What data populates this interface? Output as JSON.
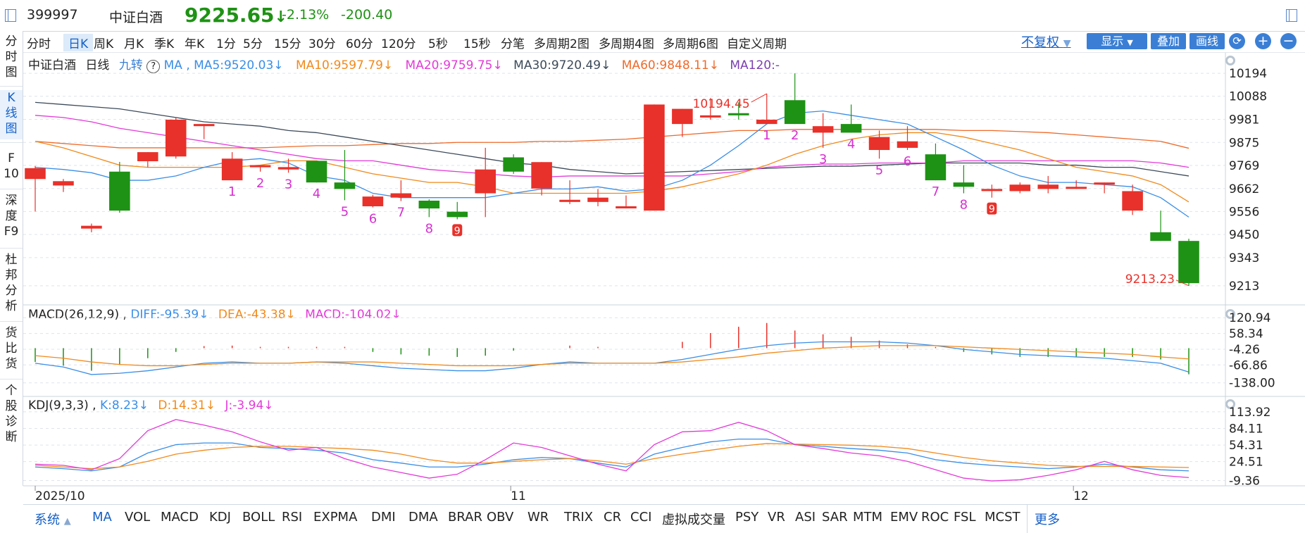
{
  "header": {
    "code": "399997",
    "name": "中证白酒",
    "price": "9225.65",
    "arrow": "↓",
    "pct": "-2.13%",
    "chg": "-200.40"
  },
  "sidebar": [
    "分时图",
    "K线图",
    "F10",
    "深度F9",
    "杜邦分析",
    "货比货",
    "个股诊断"
  ],
  "periods": [
    "分时",
    "日K",
    "周K",
    "月K",
    "季K",
    "年K",
    "1分",
    "5分",
    "15分",
    "30分",
    "60分",
    "120分",
    "5秒",
    "15秒",
    "分笔",
    "多周期2图",
    "多周期4图",
    "多周期6图",
    "自定义周期"
  ],
  "toolbar": {
    "fq": "不复权",
    "show": "显示",
    "overlay": "叠加",
    "draw": "画线",
    "plus": "+",
    "minus": "−"
  },
  "kline_title": {
    "name": "中证白酒",
    "type": "日线",
    "jz": "九转",
    "q": "?",
    "ma": "MA ,",
    "ma5": "MA5:9520.03↓",
    "ma10": "MA10:9597.79↓",
    "ma20": "MA20:9759.75↓",
    "ma30": "MA30:9720.49↓",
    "ma60": "MA60:9848.11↓",
    "ma120": "MA120:-"
  },
  "macd_title": {
    "name": "MACD(26,12,9) ,",
    "diff": "DIFF:-95.39↓",
    "dea": "DEA:-43.38↓",
    "macd": "MACD:-104.02↓"
  },
  "kdj_title": {
    "name": "KDJ(9,3,3) ,",
    "k": "K:8.23↓",
    "d": "D:14.31↓",
    "j": "J:-3.94↓"
  },
  "colors": {
    "up": "#e8312a",
    "down": "#1e9214",
    "ma5": "#3a8ee6",
    "ma10": "#f08a1c",
    "ma20": "#e33ad8",
    "ma30": "#3c4a5a",
    "ma60": "#ef6a2a",
    "ma120": "#7b3fb0"
  },
  "bottom_tabs": [
    "系统",
    "MA",
    "VOL",
    "MACD",
    "KDJ",
    "BOLL",
    "RSI",
    "EXPMA",
    "DMI",
    "DMA",
    "BRAR",
    "OBV",
    "WR",
    "TRIX",
    "CR",
    "CCI",
    "虚拟成交量",
    "PSY",
    "VR",
    "ASI",
    "SAR",
    "MTM",
    "EMV",
    "ROC",
    "FSL",
    "MCST"
  ],
  "more": "更多",
  "chart_data": {
    "type": "candlestick",
    "dates": [
      "2025/10",
      "11",
      "12"
    ],
    "date_index": [
      0,
      17,
      37
    ],
    "ylim": [
      9180,
      10240
    ],
    "y_ticks": [
      10194,
      10088,
      9981,
      9875,
      9769,
      9662,
      9556,
      9450,
      9343,
      9213
    ],
    "candles": [
      [
        9706,
        9766,
        9556,
        9756
      ],
      [
        9676,
        9706,
        9646,
        9696
      ],
      [
        9477,
        9500,
        9460,
        9490
      ],
      [
        9740,
        9785,
        9550,
        9560
      ],
      [
        9788,
        9820,
        9760,
        9830
      ],
      [
        9810,
        9990,
        9800,
        9980
      ],
      [
        9950,
        9900,
        9890,
        9960
      ],
      [
        9700,
        9830,
        9740,
        9800
      ],
      [
        9761,
        9770,
        9740,
        9770
      ],
      [
        9750,
        9800,
        9735,
        9761
      ],
      [
        9790,
        9730,
        9710,
        9690
      ],
      [
        9690,
        9840,
        9608,
        9660
      ],
      [
        9580,
        9633,
        9575,
        9625
      ],
      [
        9620,
        9700,
        9604,
        9640
      ],
      [
        9606,
        9612,
        9530,
        9570
      ],
      [
        9555,
        9600,
        9520,
        9530
      ],
      [
        9640,
        9850,
        9530,
        9750
      ],
      [
        9806,
        9820,
        9730,
        9740
      ],
      [
        9662,
        9780,
        9630,
        9784
      ],
      [
        9600,
        9700,
        9590,
        9610
      ],
      [
        9600,
        9660,
        9580,
        9620
      ],
      [
        9580,
        9630,
        9570,
        9580
      ],
      [
        9560,
        10050,
        9560,
        10050
      ],
      [
        9960,
        10010,
        9900,
        10030
      ],
      [
        9990,
        10080,
        9980,
        10000
      ],
      [
        10010,
        10060,
        9980,
        10000
      ],
      [
        9960,
        10100,
        9960,
        9980
      ],
      [
        10070,
        10194,
        10000,
        9960
      ],
      [
        9920,
        10010,
        9850,
        9950
      ],
      [
        9960,
        10050,
        9920,
        9920
      ],
      [
        9840,
        9930,
        9800,
        9900
      ],
      [
        9850,
        9950,
        9840,
        9880
      ],
      [
        9820,
        9870,
        9730,
        9700
      ],
      [
        9690,
        9770,
        9640,
        9670
      ],
      [
        9659,
        9680,
        9620,
        9660
      ],
      [
        9650,
        9690,
        9640,
        9680
      ],
      [
        9660,
        9720,
        9640,
        9680
      ],
      [
        9670,
        9700,
        9660,
        9670
      ],
      [
        9680,
        9690,
        9640,
        9690
      ],
      [
        9560,
        9680,
        9540,
        9650
      ],
      [
        9460,
        9560,
        9440,
        9420
      ],
      [
        9420,
        9430,
        9213,
        9225
      ]
    ],
    "ma5": [
      9760,
      9750,
      9735,
      9700,
      9700,
      9720,
      9760,
      9790,
      9800,
      9780,
      9720,
      9700,
      9640,
      9620,
      9620,
      9620,
      9620,
      9640,
      9660,
      9660,
      9670,
      9650,
      9660,
      9700,
      9770,
      9860,
      9960,
      10010,
      10020,
      10000,
      9980,
      9960,
      9900,
      9840,
      9770,
      9720,
      9690,
      9690,
      9680,
      9670,
      9620,
      9530
    ],
    "ma10": [
      9880,
      9850,
      9810,
      9770,
      9760,
      9760,
      9760,
      9760,
      9770,
      9790,
      9790,
      9760,
      9730,
      9710,
      9690,
      9690,
      9670,
      9640,
      9640,
      9640,
      9640,
      9640,
      9650,
      9670,
      9700,
      9730,
      9770,
      9820,
      9860,
      9890,
      9910,
      9920,
      9920,
      9900,
      9870,
      9840,
      9800,
      9760,
      9740,
      9720,
      9680,
      9600
    ],
    "ma20": [
      10000,
      9990,
      9970,
      9940,
      9920,
      9900,
      9880,
      9860,
      9840,
      9820,
      9800,
      9790,
      9790,
      9770,
      9750,
      9740,
      9730,
      9720,
      9715,
      9720,
      9720,
      9720,
      9720,
      9720,
      9730,
      9740,
      9760,
      9770,
      9775,
      9775,
      9780,
      9780,
      9780,
      9790,
      9790,
      9790,
      9790,
      9790,
      9790,
      9790,
      9780,
      9760
    ],
    "ma30": [
      10060,
      10050,
      10040,
      10030,
      10010,
      9990,
      9970,
      9960,
      9950,
      9930,
      9920,
      9900,
      9880,
      9860,
      9840,
      9820,
      9800,
      9780,
      9770,
      9750,
      9740,
      9730,
      9735,
      9740,
      9745,
      9750,
      9755,
      9760,
      9765,
      9765,
      9770,
      9775,
      9780,
      9780,
      9780,
      9780,
      9770,
      9770,
      9760,
      9760,
      9740,
      9720
    ],
    "ma60": [
      9880,
      9870,
      9860,
      9850,
      9850,
      9850,
      9850,
      9850,
      9850,
      9855,
      9860,
      9860,
      9865,
      9870,
      9870,
      9875,
      9875,
      9875,
      9880,
      9880,
      9885,
      9890,
      9900,
      9910,
      9920,
      9930,
      9930,
      9935,
      9935,
      9935,
      9935,
      9935,
      9935,
      9930,
      9930,
      9925,
      9920,
      9910,
      9900,
      9890,
      9880,
      9848
    ],
    "nine_labels": [
      [
        "1",
        7,
        "below"
      ],
      [
        "2",
        8,
        "below"
      ],
      [
        "3",
        9,
        "below"
      ],
      [
        "4",
        10,
        "below"
      ],
      [
        "5",
        11,
        "below"
      ],
      [
        "6",
        12,
        "below"
      ],
      [
        "7",
        13,
        "below"
      ],
      [
        "8",
        14,
        "below"
      ],
      [
        "9",
        15,
        "below"
      ],
      [
        "1",
        26,
        "below"
      ],
      [
        "2",
        27,
        "below"
      ],
      [
        "3",
        28,
        "below"
      ],
      [
        "4",
        29,
        "below"
      ],
      [
        "5",
        30,
        "below"
      ],
      [
        "6",
        31,
        "below"
      ],
      [
        "7",
        32,
        "below"
      ],
      [
        "8",
        33,
        "below"
      ],
      [
        "9",
        34,
        "below"
      ]
    ],
    "annotations": [
      {
        "text": "10194.45",
        "index": 26
      },
      {
        "text": "9213.23",
        "index": 41
      }
    ],
    "macd": {
      "ylim": [
        -150,
        130
      ],
      "ticks": [
        120.94,
        58.34,
        -4.26,
        -66.86,
        -138.0
      ],
      "diff": [
        -60,
        -75,
        -105,
        -100,
        -90,
        -75,
        -60,
        -55,
        -60,
        -60,
        -55,
        -60,
        -70,
        -80,
        -85,
        -90,
        -90,
        -80,
        -65,
        -55,
        -60,
        -60,
        -60,
        -45,
        -25,
        -5,
        10,
        20,
        25,
        25,
        25,
        20,
        10,
        -5,
        -15,
        -25,
        -30,
        -35,
        -40,
        -50,
        -60,
        -95
      ],
      "dea": [
        -30,
        -40,
        -55,
        -65,
        -70,
        -70,
        -65,
        -60,
        -60,
        -60,
        -55,
        -55,
        -55,
        -60,
        -65,
        -70,
        -70,
        -70,
        -65,
        -60,
        -60,
        -60,
        -60,
        -55,
        -45,
        -35,
        -20,
        -10,
        0,
        5,
        10,
        10,
        10,
        5,
        0,
        -5,
        -10,
        -15,
        -20,
        -25,
        -35,
        -43
      ],
      "bars": [
        -55,
        -70,
        -90,
        -65,
        -40,
        -15,
        8,
        10,
        5,
        5,
        5,
        5,
        -15,
        -25,
        -30,
        -35,
        -30,
        -10,
        0,
        10,
        5,
        0,
        0,
        25,
        60,
        85,
        100,
        70,
        55,
        45,
        30,
        15,
        5,
        -15,
        -25,
        -35,
        -35,
        -35,
        -35,
        -35,
        -45,
        -104
      ]
    },
    "kdj": {
      "ylim": [
        -15,
        120
      ],
      "ticks": [
        113.92,
        84.11,
        54.31,
        24.51,
        -9.36
      ],
      "k": [
        15,
        12,
        8,
        15,
        40,
        55,
        58,
        58,
        50,
        48,
        45,
        40,
        28,
        22,
        15,
        15,
        20,
        28,
        32,
        30,
        22,
        15,
        38,
        50,
        60,
        65,
        65,
        55,
        52,
        48,
        45,
        40,
        28,
        22,
        18,
        15,
        12,
        15,
        20,
        15,
        10,
        8
      ],
      "d": [
        18,
        15,
        12,
        15,
        25,
        38,
        45,
        50,
        52,
        52,
        50,
        48,
        45,
        38,
        28,
        22,
        22,
        25,
        28,
        30,
        26,
        20,
        30,
        38,
        45,
        52,
        57,
        56,
        55,
        54,
        52,
        48,
        40,
        32,
        26,
        22,
        18,
        16,
        16,
        16,
        15,
        14
      ],
      "j": [
        20,
        18,
        10,
        30,
        80,
        100,
        90,
        78,
        60,
        45,
        50,
        30,
        15,
        5,
        -5,
        2,
        28,
        58,
        50,
        35,
        20,
        8,
        55,
        78,
        80,
        95,
        80,
        55,
        48,
        40,
        35,
        25,
        10,
        -5,
        -10,
        -8,
        0,
        10,
        25,
        10,
        0,
        -4
      ]
    }
  }
}
